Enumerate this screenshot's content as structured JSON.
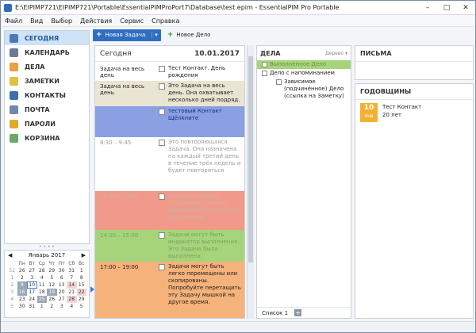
{
  "window": {
    "title": "E:\\EIPIMP721\\EIPIMP721\\Portable\\EssentialPIMProPort7\\Database\\test.epim - EssentialPIM Pro Portable",
    "minimize": "–",
    "maximize": "□",
    "close": "✕"
  },
  "menu": [
    "Файл",
    "Вид",
    "Выбор",
    "Действия",
    "Сервис",
    "Справка"
  ],
  "toolbar": {
    "new_task": "Новая Задача",
    "new_deal": "Новое Дело"
  },
  "sidebar": {
    "items": [
      {
        "label": "СЕГОДНЯ",
        "icon": "today-icon",
        "color": "#4a7bb7"
      },
      {
        "label": "КАЛЕНДАРЬ",
        "icon": "calendar-icon",
        "color": "#6b7c8f"
      },
      {
        "label": "ДЕЛА",
        "icon": "tasks-icon",
        "color": "#e8a040"
      },
      {
        "label": "ЗАМЕТКИ",
        "icon": "notes-icon",
        "color": "#e0c040"
      },
      {
        "label": "КОНТАКТЫ",
        "icon": "contacts-icon",
        "color": "#3a6fb0"
      },
      {
        "label": "ПОЧТА",
        "icon": "mail-icon",
        "color": "#6c8ab0"
      },
      {
        "label": "ПАРОЛИ",
        "icon": "passwords-icon",
        "color": "#e2a82a"
      },
      {
        "label": "КОРЗИНА",
        "icon": "trash-icon",
        "color": "#6aa86a"
      }
    ]
  },
  "calendar": {
    "month": "Январь",
    "year": "2017",
    "weekdays": [
      "Пн",
      "Вт",
      "Ср",
      "Чт",
      "Пт",
      "Сб",
      "Вс"
    ],
    "weeks": [
      {
        "wk": "52",
        "days": [
          "26",
          "27",
          "28",
          "29",
          "30",
          "31",
          "1"
        ]
      },
      {
        "wk": "1",
        "days": [
          "2",
          "3",
          "4",
          "5",
          "6",
          "7",
          "8"
        ]
      },
      {
        "wk": "2",
        "days": [
          "9",
          "10",
          "11",
          "12",
          "13",
          "14",
          "15"
        ]
      },
      {
        "wk": "3",
        "days": [
          "16",
          "17",
          "18",
          "19",
          "20",
          "21",
          "22"
        ]
      },
      {
        "wk": "4",
        "days": [
          "23",
          "24",
          "25",
          "26",
          "27",
          "28",
          "29"
        ]
      },
      {
        "wk": "5",
        "days": [
          "30",
          "31",
          "1",
          "2",
          "3",
          "4",
          "5"
        ]
      }
    ]
  },
  "today": {
    "label": "Сегодня",
    "date": "10.01.2017",
    "events": [
      {
        "time": "Задача на весь день",
        "text": "Тест Контакт. День рождения",
        "bg": "#ffffff",
        "textcolor": "#222"
      },
      {
        "time": "Задача на весь день",
        "text": "Это Задача на весь день. Она охватывает несколько дней подряд.",
        "bg": "#e9e5d2",
        "textcolor": "#222"
      },
      {
        "time": "",
        "text": "тестовый Контакт Щёлкните",
        "bg": "#8aa0e2",
        "textcolor": "#1d2a80"
      },
      {
        "time": "8:30 – 9:45",
        "text": "Это повторяющаяся Задача. Она назначена на каждый третий день в течение трёх недель и будет повторяться",
        "bg": "#ffffff",
        "textcolor": "#9a9a9a"
      },
      {
        "time": "12:00 – 13:00",
        "text": "Отметьте Задачу, отображает сколько времени осталось до её выполнения",
        "bg": "#f19a8a",
        "textcolor": "#c9b2aa"
      },
      {
        "time": "14:00 – 15:00",
        "text": "Задачи могут быть индикатор выполнения. Это Задача была выполнена.",
        "bg": "#a6d47a",
        "textcolor": "#7ea060"
      },
      {
        "time": "17:00 – 19:00",
        "text": "Задачи могут быть легко перемещены или скопированы. Попробуйте перетащить эту Задачу мышкой на другое время.",
        "bg": "#f5b27a",
        "textcolor": "#222"
      }
    ]
  },
  "deals": {
    "title": "ДЕЛА",
    "view": "Дерево",
    "items": [
      {
        "text": "Выполненное Дело",
        "level": 0,
        "done": true
      },
      {
        "text": "Дело с напоминанием",
        "level": 0,
        "done": false
      },
      {
        "text": "Зависимое (подчинённое) Дело (ссылка на Заметку)",
        "level": 1,
        "done": false
      }
    ],
    "list_tab": "Список 1",
    "add_label": "+"
  },
  "mail": {
    "title": "ПИСЬМА"
  },
  "birthdays": {
    "title": "ГОДОВЩИНЫ",
    "items": [
      {
        "day": "10",
        "month": "янв",
        "name": "Тест Контакт",
        "age": "20 лет"
      }
    ]
  }
}
